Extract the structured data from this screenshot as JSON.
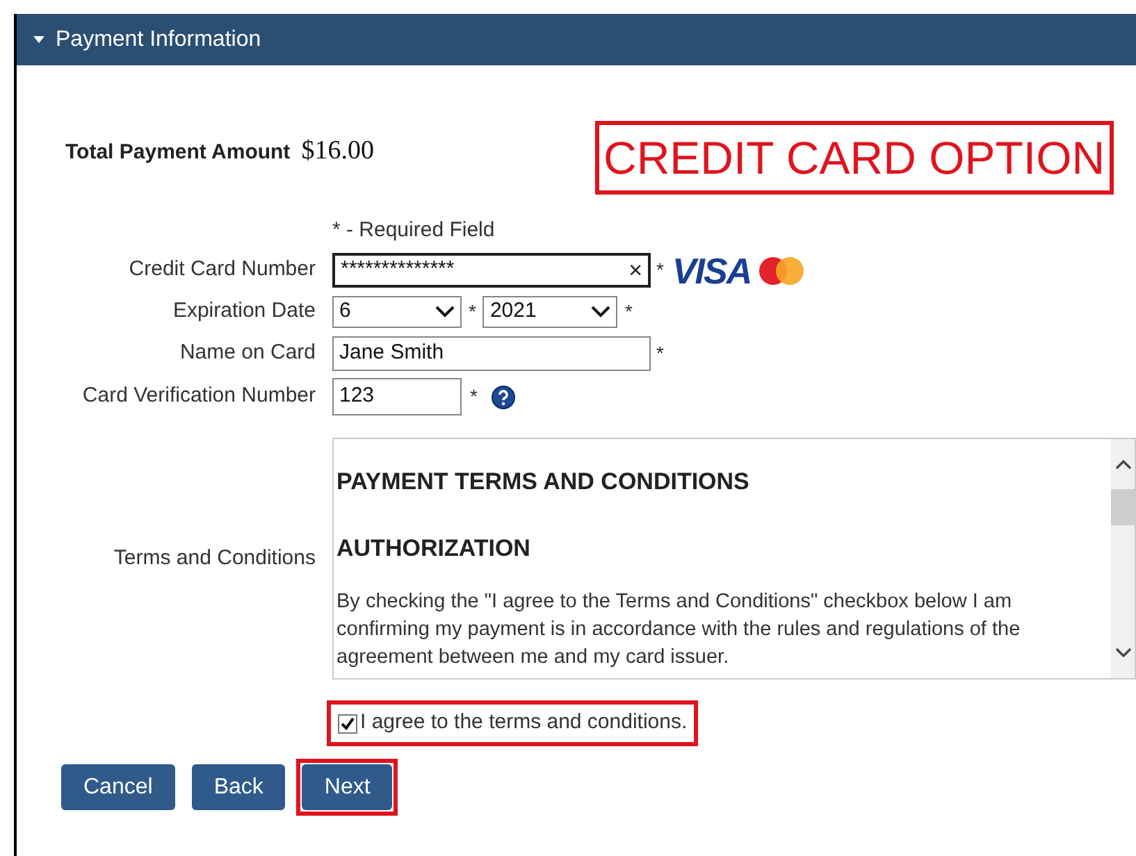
{
  "panel": {
    "title": "Payment Information",
    "expanded": true
  },
  "total": {
    "label": "Total Payment Amount",
    "value": "$16.00"
  },
  "annotation": {
    "text": "CREDIT CARD OPTION"
  },
  "required_note": "* - Required Field",
  "fields": [
    {
      "kind": "text",
      "label": "Credit Card Number",
      "value": "**************",
      "required_mark": "*",
      "clear": "×",
      "focused": true
    },
    {
      "kind": "date",
      "label": "Expiration Date",
      "month": "6",
      "year": "2021",
      "required_mark": "*"
    },
    {
      "kind": "text",
      "label": "Name on Card",
      "value": "Jane Smith",
      "required_mark": "*",
      "focused": false
    },
    {
      "kind": "cvv",
      "label": "Card Verification Number",
      "value": "123",
      "required_mark": "*"
    }
  ],
  "card_logo": "VISA",
  "terms": {
    "label": "Terms and Conditions",
    "heading": "PAYMENT TERMS AND CONDITIONS",
    "subheading": "AUTHORIZATION",
    "body": "By checking the \"I agree to the Terms and Conditions\" checkbox below I am confirming my payment is in accordance with the rules and regulations of the agreement between me and my card issuer."
  },
  "agree": {
    "label": "I agree to the terms and conditions.",
    "checked": true,
    "highlighted": true
  },
  "buttons": [
    {
      "label": "Cancel",
      "highlighted": false
    },
    {
      "label": "Back",
      "highlighted": false
    },
    {
      "label": "Next",
      "highlighted": true
    }
  ]
}
